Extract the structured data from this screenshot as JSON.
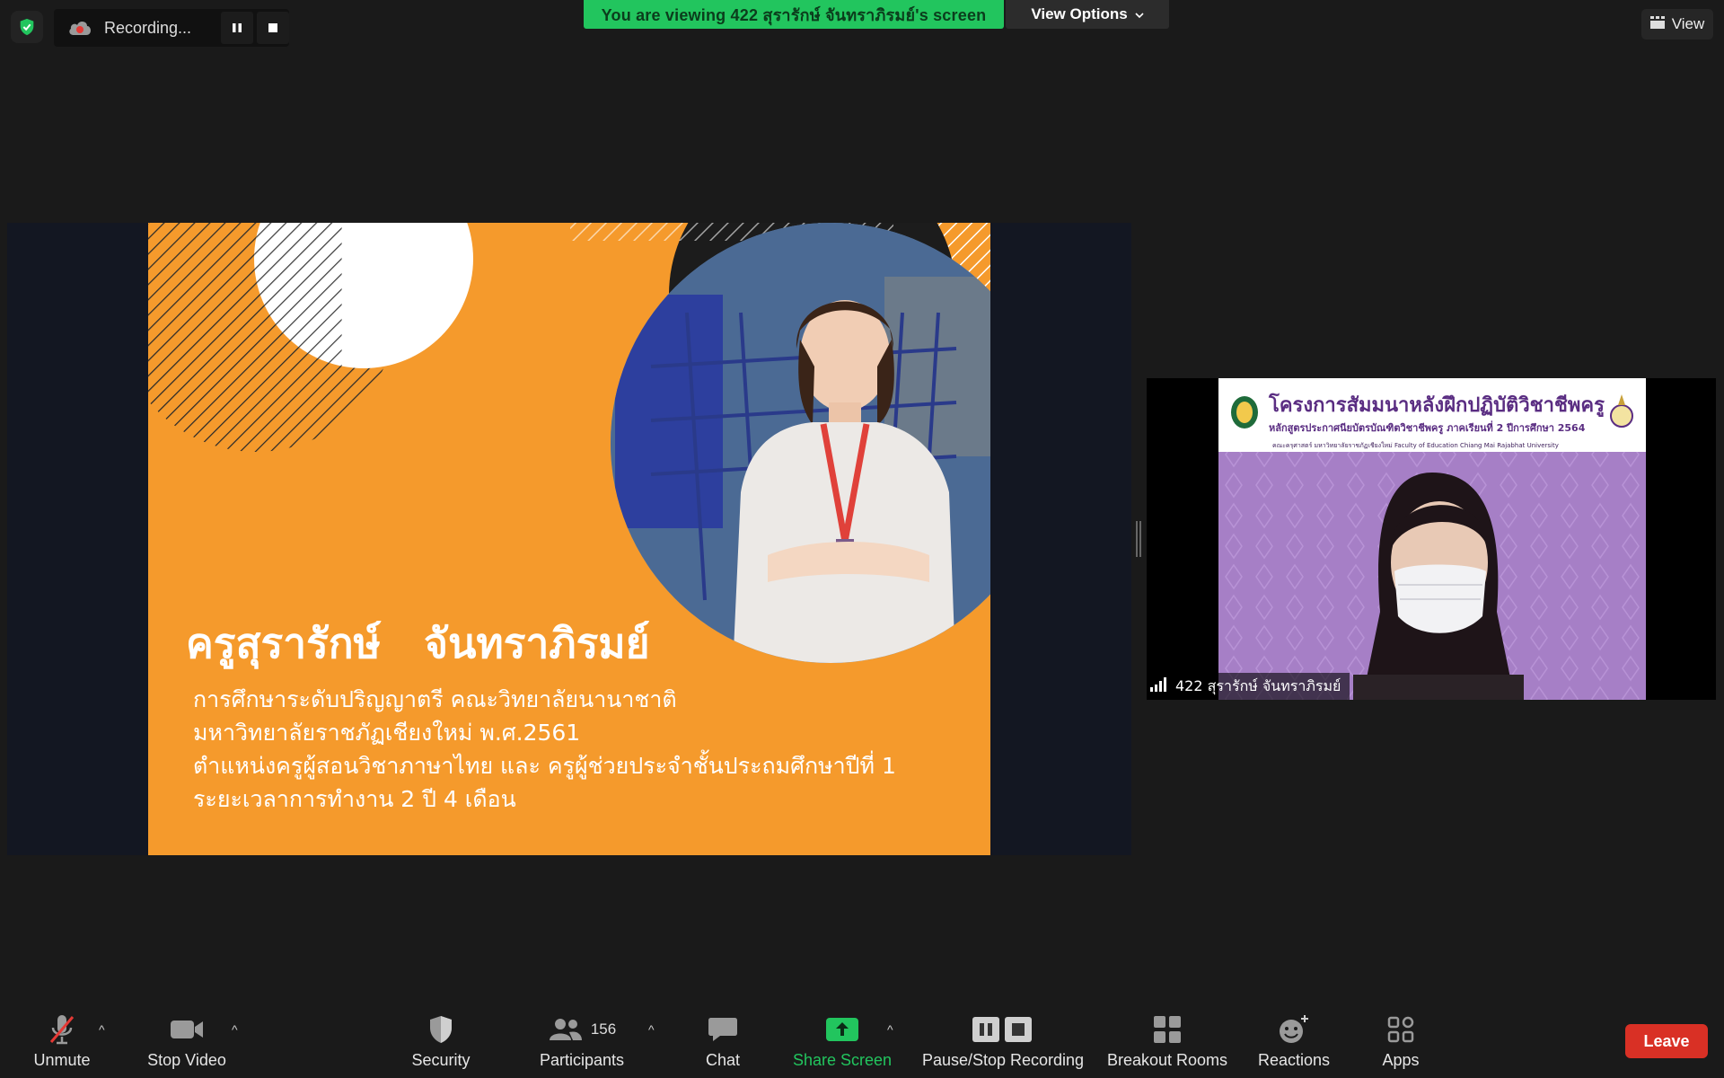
{
  "top": {
    "recording_label": "Recording...",
    "viewing_banner": "You are viewing 422 สุรารักษ์  จันทราภิรมย์'s screen",
    "view_options_label": "View Options",
    "view_label": "View"
  },
  "slide": {
    "name": "ครูสุรารักษ์   จันทราภิรมย์",
    "lines": [
      "การศึกษาระดับปริญญาตรี คณะวิทยาลัยนานาชาติ",
      "มหาวิทยาลัยราชภัฏเชียงใหม่ พ.ศ.2561",
      "ตำแหน่งครูผู้สอนวิชาภาษาไทย และ ครูผู้ช่วยประจำชั้นประถมศึกษาปีที่ 1",
      "ระยะเวลาการทำงาน 2 ปี 4 เดือน"
    ]
  },
  "tile": {
    "bg_title": "โครงการสัมมนาหลังฝึกปฏิบัติวิชาชีพครู",
    "bg_subtitle": "หลักสูตรประกาศนียบัตรบัณฑิตวิชาชีพครู ภาคเรียนที่ 2 ปีการศึกษา 2564",
    "bg_subtitle2": "คณะครุศาสตร์ มหาวิทยาลัยราชภัฏเชียงใหม่ Faculty of Education Chiang Mai Rajabhat University",
    "participant_name": "422 สุรารักษ์  จันทราภิรมย์"
  },
  "toolbar": {
    "unmute": "Unmute",
    "stop_video": "Stop Video",
    "security": "Security",
    "participants": "Participants",
    "participants_count": "156",
    "chat": "Chat",
    "share_screen": "Share Screen",
    "pause_stop_recording": "Pause/Stop Recording",
    "breakout_rooms": "Breakout Rooms",
    "reactions": "Reactions",
    "apps": "Apps",
    "leave": "Leave"
  },
  "colors": {
    "accent_green": "#22c55e",
    "leave_red": "#d93025",
    "slide_orange": "#f59a2c"
  }
}
